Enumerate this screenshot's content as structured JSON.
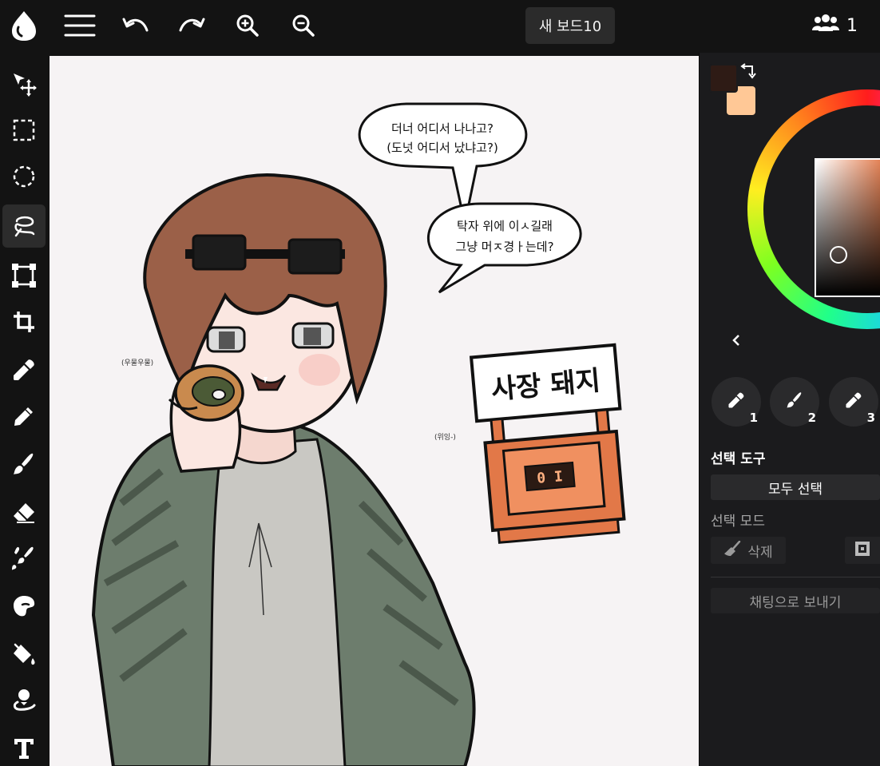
{
  "topbar": {
    "icons": [
      "app-logo-icon",
      "menu-icon",
      "undo-icon",
      "redo-icon",
      "zoom-in-icon",
      "zoom-out-icon"
    ],
    "board_title": "새 보드10",
    "user_count": "1"
  },
  "toolbar": {
    "tools": [
      "move",
      "rect-select",
      "ellipse-select",
      "lasso-select",
      "transform",
      "crop",
      "eyedropper",
      "pencil",
      "brush",
      "eraser",
      "blend",
      "smudge",
      "fill",
      "liquify",
      "text"
    ],
    "active_tool": "lasso-select"
  },
  "canvas": {
    "bubble1_line1": "더너 어디서 나나고?",
    "bubble1_line2": "(도넛 어디서 났냐고?)",
    "bubble2_line1": "탁자 위에 이ㅅ길래",
    "bubble2_line2": "그냥 머ㅈ경ㅏ는데?",
    "sfx_left": "(우물우물)",
    "sfx_right": "(위잉-)",
    "sign_text": "사장 돼지",
    "robot_face": "0 I"
  },
  "panel": {
    "colors": {
      "primary": "#2e1b15",
      "secondary": "#ffc896",
      "accent": "#e27848"
    },
    "brush_slots": [
      "1",
      "2",
      "3"
    ],
    "selection_tool_title": "선택 도구",
    "select_all_label": "모두 선택",
    "selection_mode_label": "선택 모드",
    "delete_label": "삭제",
    "send_to_chat_label": "채팅으로 보내기"
  }
}
